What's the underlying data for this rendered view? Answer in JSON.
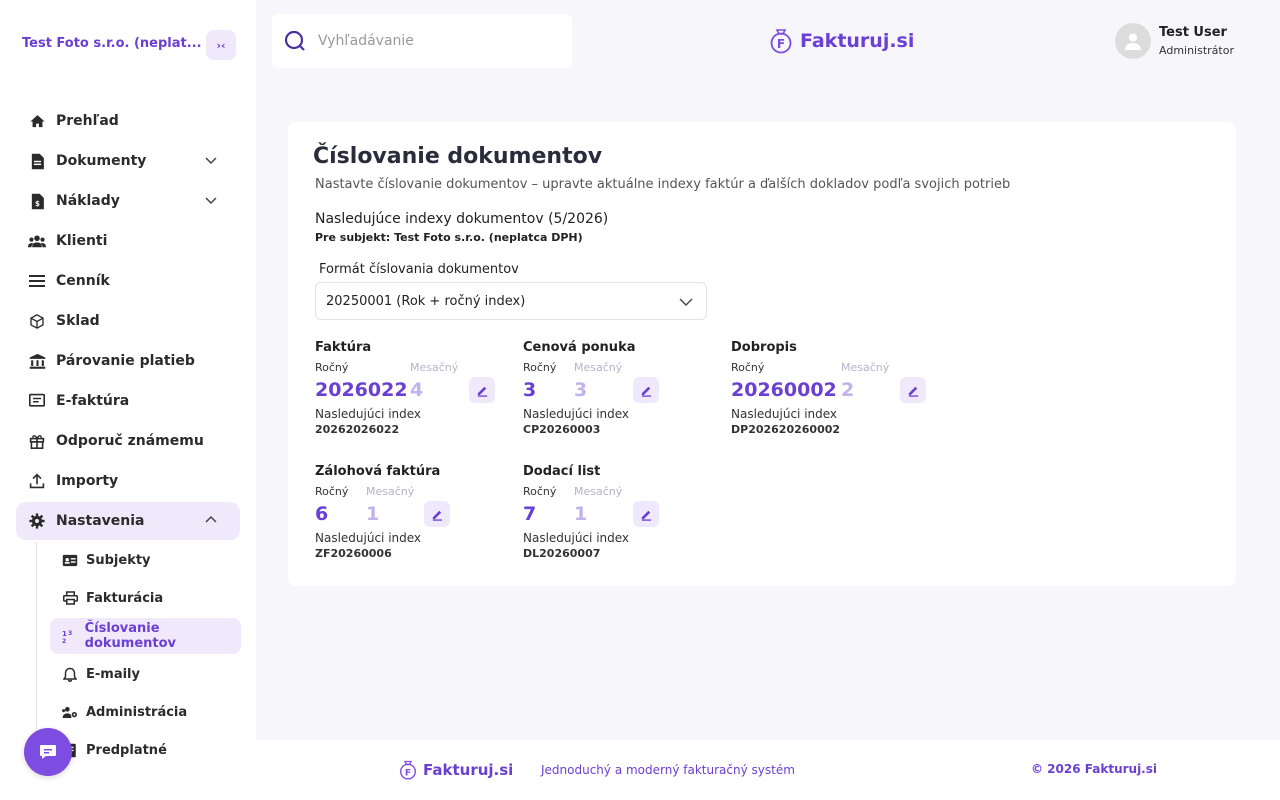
{
  "sidebar": {
    "company": "Test Foto s.r.o. (neplat...",
    "collapse_label": "›‹",
    "items": [
      {
        "label": "Prehľad"
      },
      {
        "label": "Dokumenty"
      },
      {
        "label": "Náklady"
      },
      {
        "label": "Klienti"
      },
      {
        "label": "Cenník"
      },
      {
        "label": "Sklad"
      },
      {
        "label": "Párovanie platieb"
      },
      {
        "label": "E-faktúra"
      },
      {
        "label": "Odporuč známemu"
      },
      {
        "label": "Importy"
      },
      {
        "label": "Nastavenia"
      }
    ],
    "sub_items": [
      {
        "label": "Subjekty"
      },
      {
        "label": "Fakturácia"
      },
      {
        "label": "Číslovanie dokumentov"
      },
      {
        "label": "E-maily"
      },
      {
        "label": "Administrácia"
      },
      {
        "label": "Predplatné"
      }
    ]
  },
  "header": {
    "search_placeholder": "Vyhľadávanie",
    "logo": "Fakturuj.si",
    "user_name": "Test User",
    "user_role": "Administrátor"
  },
  "main": {
    "title": "Číslovanie dokumentov",
    "subtitle": "Nastavte číslovanie dokumentov – upravte aktuálne indexy faktúr a ďalších dokladov podľa svojich potrieb",
    "section_title": "Nasledujúce indexy dokumentov (5/2026)",
    "section_sub": "Pre subjekt: Test Foto s.r.o. (neplatca DPH)",
    "format_label": "Formát číslovania dokumentov",
    "format_value": "20250001 (Rok + ročný index)",
    "yearly_label": "Ročný",
    "monthly_label": "Mesačný",
    "next_label": "Nasledujúci index",
    "docs": [
      {
        "title": "Faktúra",
        "yearly": "2026022",
        "monthly": "4",
        "next": "20262026022"
      },
      {
        "title": "Cenová ponuka",
        "yearly": "3",
        "monthly": "3",
        "next": "CP20260003"
      },
      {
        "title": "Dobropis",
        "yearly": "20260002",
        "monthly": "2",
        "next": "DP202620260002"
      },
      {
        "title": "Zálohová faktúra",
        "yearly": "6",
        "monthly": "1",
        "next": "ZF20260006"
      },
      {
        "title": "Dodací list",
        "yearly": "7",
        "monthly": "1",
        "next": "DL20260007"
      }
    ]
  },
  "footer": {
    "logo": "Fakturuj.si",
    "tagline": "Jednoduchý a moderný fakturačný systém",
    "copyright": "© 2026 Fakturuj.si"
  },
  "colors": {
    "accent": "#6b3fd4",
    "accent_light": "#efe9fb",
    "background": "#f7f6fb"
  }
}
